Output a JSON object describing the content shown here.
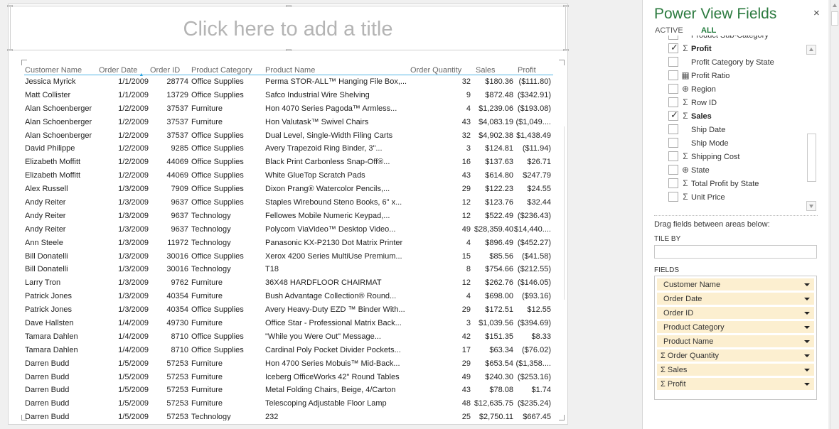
{
  "report": {
    "title_placeholder": "Click here to add a title"
  },
  "table": {
    "columns": [
      "Customer Name",
      "Order Date",
      "Order ID",
      "Product Category",
      "Product Name",
      "Order Quantity",
      "Sales",
      "Profit"
    ],
    "sorted_column": "Order Date",
    "rows": [
      [
        "Jessica Myrick",
        "1/1/2009",
        "28774",
        "Office Supplies",
        "Perma STOR-ALL™ Hanging File Box,...",
        "32",
        "$180.36",
        "($111.80)"
      ],
      [
        "Matt Collister",
        "1/1/2009",
        "13729",
        "Office Supplies",
        "Safco Industrial Wire Shelving",
        "9",
        "$872.48",
        "($342.91)"
      ],
      [
        "Alan Schoenberger",
        "1/2/2009",
        "37537",
        "Furniture",
        "Hon 4070 Series Pagoda™ Armless...",
        "4",
        "$1,239.06",
        "($193.08)"
      ],
      [
        "Alan Schoenberger",
        "1/2/2009",
        "37537",
        "Furniture",
        "Hon Valutask™ Swivel Chairs",
        "43",
        "$4,083.19",
        "($1,049...."
      ],
      [
        "Alan Schoenberger",
        "1/2/2009",
        "37537",
        "Office Supplies",
        "Dual Level, Single-Width Filing Carts",
        "32",
        "$4,902.38",
        "$1,438.49"
      ],
      [
        "David Philippe",
        "1/2/2009",
        "9285",
        "Office Supplies",
        "Avery Trapezoid Ring Binder, 3\"...",
        "3",
        "$124.81",
        "($11.94)"
      ],
      [
        "Elizabeth Moffitt",
        "1/2/2009",
        "44069",
        "Office Supplies",
        "Black Print Carbonless Snap-Off®...",
        "16",
        "$137.63",
        "$26.71"
      ],
      [
        "Elizabeth Moffitt",
        "1/2/2009",
        "44069",
        "Office Supplies",
        "White GlueTop Scratch Pads",
        "43",
        "$614.80",
        "$247.79"
      ],
      [
        "Alex Russell",
        "1/3/2009",
        "7909",
        "Office Supplies",
        "Dixon Prang® Watercolor Pencils,...",
        "29",
        "$122.23",
        "$24.55"
      ],
      [
        "Andy Reiter",
        "1/3/2009",
        "9637",
        "Office Supplies",
        "Staples Wirebound Steno Books, 6\" x...",
        "12",
        "$123.76",
        "$32.44"
      ],
      [
        "Andy Reiter",
        "1/3/2009",
        "9637",
        "Technology",
        "Fellowes Mobile Numeric Keypad,...",
        "12",
        "$522.49",
        "($236.43)"
      ],
      [
        "Andy Reiter",
        "1/3/2009",
        "9637",
        "Technology",
        "Polycom ViaVideo™ Desktop Video...",
        "49",
        "$28,359.40",
        "$14,440...."
      ],
      [
        "Ann Steele",
        "1/3/2009",
        "11972",
        "Technology",
        "Panasonic KX-P2130 Dot Matrix Printer",
        "4",
        "$896.49",
        "($452.27)"
      ],
      [
        "Bill Donatelli",
        "1/3/2009",
        "30016",
        "Office Supplies",
        "Xerox 4200 Series MultiUse Premium...",
        "15",
        "$85.56",
        "($41.58)"
      ],
      [
        "Bill Donatelli",
        "1/3/2009",
        "30016",
        "Technology",
        "T18",
        "8",
        "$754.66",
        "($212.55)"
      ],
      [
        "Larry Tron",
        "1/3/2009",
        "9762",
        "Furniture",
        "36X48 HARDFLOOR CHAIRMAT",
        "12",
        "$262.76",
        "($146.05)"
      ],
      [
        "Patrick Jones",
        "1/3/2009",
        "40354",
        "Furniture",
        "Bush Advantage Collection® Round...",
        "4",
        "$698.00",
        "($93.16)"
      ],
      [
        "Patrick Jones",
        "1/3/2009",
        "40354",
        "Office Supplies",
        "Avery Heavy-Duty EZD ™ Binder With...",
        "29",
        "$172.51",
        "$12.55"
      ],
      [
        "Dave Hallsten",
        "1/4/2009",
        "49730",
        "Furniture",
        "Office Star - Professional Matrix Back...",
        "3",
        "$1,039.56",
        "($394.69)"
      ],
      [
        "Tamara Dahlen",
        "1/4/2009",
        "8710",
        "Office Supplies",
        "\"While you Were Out\" Message...",
        "42",
        "$151.35",
        "$8.33"
      ],
      [
        "Tamara Dahlen",
        "1/4/2009",
        "8710",
        "Office Supplies",
        "Cardinal Poly Pocket Divider Pockets...",
        "17",
        "$63.34",
        "($76.02)"
      ],
      [
        "Darren Budd",
        "1/5/2009",
        "57253",
        "Furniture",
        "Hon 4700 Series Mobuis™ Mid-Back...",
        "29",
        "$653.54",
        "($1,358...."
      ],
      [
        "Darren Budd",
        "1/5/2009",
        "57253",
        "Furniture",
        "Iceberg OfficeWorks 42\" Round Tables",
        "49",
        "$240.30",
        "($253.16)"
      ],
      [
        "Darren Budd",
        "1/5/2009",
        "57253",
        "Furniture",
        "Metal Folding Chairs, Beige, 4/Carton",
        "43",
        "$78.08",
        "$1.74"
      ],
      [
        "Darren Budd",
        "1/5/2009",
        "57253",
        "Furniture",
        "Telescoping Adjustable Floor Lamp",
        "48",
        "$12,635.75",
        "($235.24)"
      ],
      [
        "Darren Budd",
        "1/5/2009",
        "57253",
        "Technology",
        "232",
        "25",
        "$2,750.11",
        "$667.45"
      ]
    ]
  },
  "field_pane": {
    "title": "Power View Fields",
    "close_glyph": "×",
    "tabs": {
      "active": "ACTIVE",
      "all": "ALL"
    },
    "fields": [
      {
        "label": "Product Sub-Category",
        "checked": false,
        "icon": "",
        "bold": false
      },
      {
        "label": "Profit",
        "checked": true,
        "icon": "Σ",
        "bold": true
      },
      {
        "label": "Profit Category by State",
        "checked": false,
        "icon": "",
        "bold": false
      },
      {
        "label": "Profit Ratio",
        "checked": false,
        "icon": "▦",
        "bold": false
      },
      {
        "label": "Region",
        "checked": false,
        "icon": "⊕",
        "bold": false
      },
      {
        "label": "Row ID",
        "checked": false,
        "icon": "Σ",
        "bold": false
      },
      {
        "label": "Sales",
        "checked": true,
        "icon": "Σ",
        "bold": true
      },
      {
        "label": "Ship Date",
        "checked": false,
        "icon": "",
        "bold": false
      },
      {
        "label": "Ship Mode",
        "checked": false,
        "icon": "",
        "bold": false
      },
      {
        "label": "Shipping Cost",
        "checked": false,
        "icon": "Σ",
        "bold": false
      },
      {
        "label": "State",
        "checked": false,
        "icon": "⊕",
        "bold": false
      },
      {
        "label": "Total Profit by State",
        "checked": false,
        "icon": "Σ",
        "bold": false
      },
      {
        "label": "Unit Price",
        "checked": false,
        "icon": "Σ",
        "bold": false
      }
    ],
    "drag_hint": "Drag fields between areas below:",
    "tile_by_label": "TILE BY",
    "fields_label": "FIELDS",
    "well_items": [
      {
        "label": "Customer Name",
        "sigma": false
      },
      {
        "label": "Order Date",
        "sigma": false
      },
      {
        "label": "Order ID",
        "sigma": false
      },
      {
        "label": "Product Category",
        "sigma": false
      },
      {
        "label": "Product Name",
        "sigma": false
      },
      {
        "label": "Σ Order Quantity",
        "sigma": true
      },
      {
        "label": "Σ Sales",
        "sigma": true
      },
      {
        "label": "Σ Profit",
        "sigma": true
      }
    ]
  }
}
